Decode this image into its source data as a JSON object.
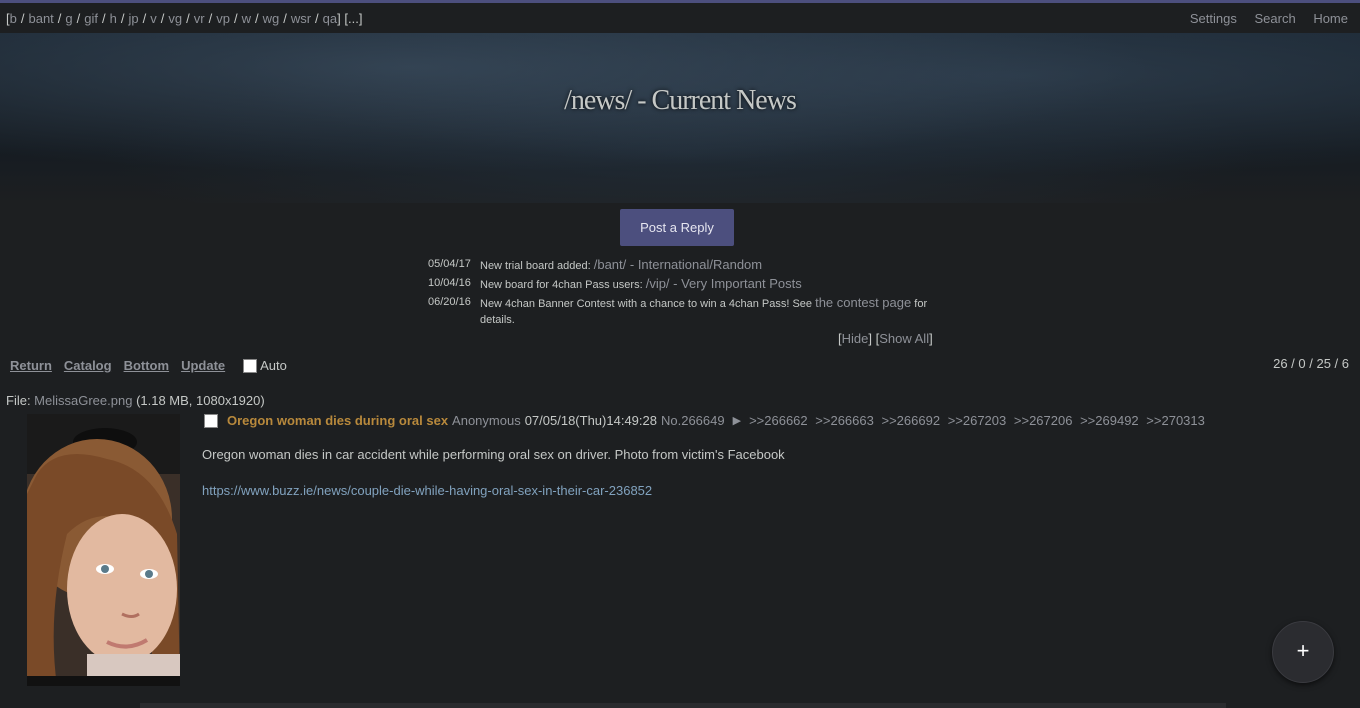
{
  "navbar": {
    "boards": [
      "b",
      "bant",
      "g",
      "gif",
      "h",
      "jp",
      "v",
      "vg",
      "vr",
      "vp",
      "w",
      "wg",
      "wsr",
      "qa"
    ],
    "more": "[...]",
    "settings": "Settings",
    "search": "Search",
    "home": "Home"
  },
  "board_title": "/news/ - Current News",
  "post_reply_label": "Post a Reply",
  "news": [
    {
      "date": "05/04/17",
      "text": "New trial board added: ",
      "link": "/bant/ - International/Random",
      "after": ""
    },
    {
      "date": "10/04/16",
      "text": "New board for 4chan Pass users: ",
      "link": "/vip/ - Very Important Posts",
      "after": ""
    },
    {
      "date": "06/20/16",
      "text": "New 4chan Banner Contest with a chance to win a 4chan Pass! See ",
      "link": "the contest page",
      "after": " for details."
    }
  ],
  "news_controls": {
    "hide": "Hide",
    "show_all": "Show All"
  },
  "thread_nav": {
    "return": "Return",
    "catalog": "Catalog",
    "bottom": "Bottom",
    "update": "Update",
    "auto": "Auto"
  },
  "stats": "26 / 0 / 25 / 6",
  "file": {
    "label": "File: ",
    "name": "MelissaGree.png",
    "meta": " (1.18 MB, 1080x1920)"
  },
  "post": {
    "subject": "Oregon woman dies during oral sex",
    "name": "Anonymous",
    "date": "07/05/18(Thu)14:49:28",
    "number": "No.266649",
    "backlinks": [
      ">>266662",
      ">>266663",
      ">>266692",
      ">>267203",
      ">>267206",
      ">>269492",
      ">>270313"
    ],
    "comment_line1": "Oregon woman dies in car accident while performing oral sex on driver. Photo from victim's Facebook",
    "comment_link": "https://www.buzz.ie/news/couple-die-while-having-oral-sex-in-their-car-236852"
  },
  "fab_label": "+",
  "icons": {
    "fab": "plus-icon",
    "menu": "triangle-right-icon"
  }
}
